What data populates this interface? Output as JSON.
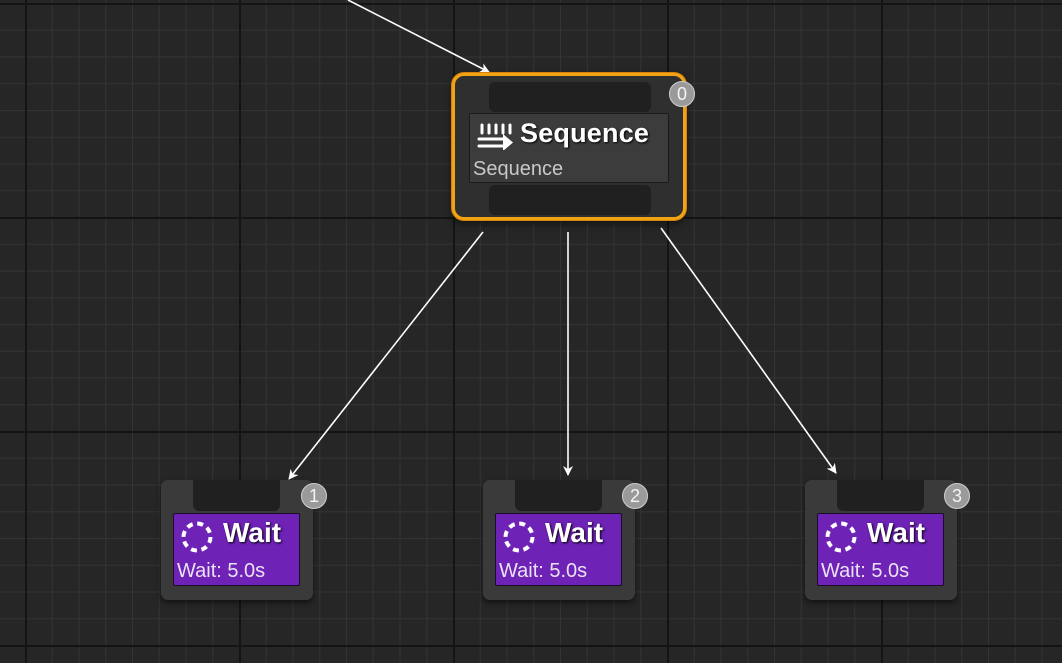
{
  "composite": {
    "title": "Sequence",
    "subtitle": "Sequence",
    "index": "0",
    "icon": "sequence-icon",
    "accent_color": "#f0a414"
  },
  "tasks": [
    {
      "title": "Wait",
      "subtitle": "Wait: 5.0s",
      "index": "1",
      "icon": "wait-icon"
    },
    {
      "title": "Wait",
      "subtitle": "Wait: 5.0s",
      "index": "2",
      "icon": "wait-icon"
    },
    {
      "title": "Wait",
      "subtitle": "Wait: 5.0s",
      "index": "3",
      "icon": "wait-icon"
    }
  ],
  "colors": {
    "canvas_background": "#262626",
    "task_color": "#6e22b6",
    "wire_color": "#ffffff"
  }
}
